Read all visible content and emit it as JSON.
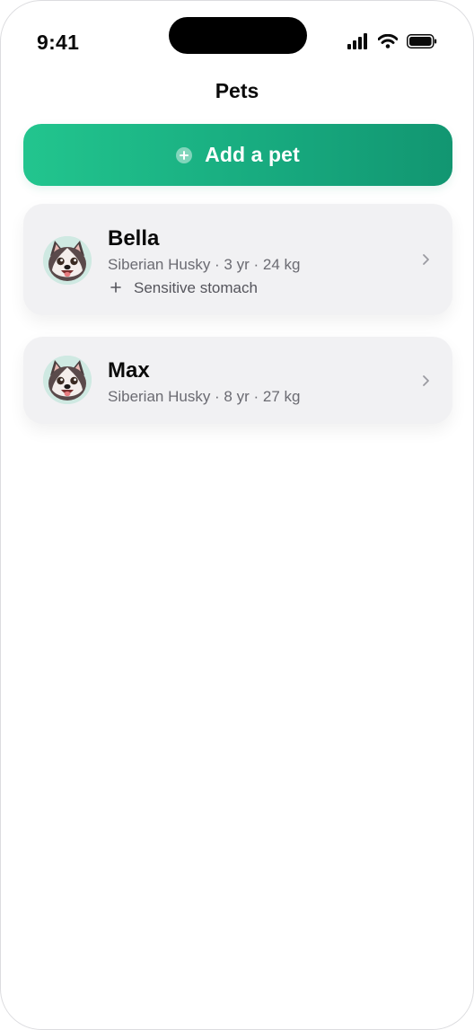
{
  "status_bar": {
    "time": "9:41"
  },
  "nav": {
    "title": "Pets"
  },
  "add_button": {
    "label": "Add a pet",
    "icon": "plus-circle-icon"
  },
  "pets": [
    {
      "name": "Bella",
      "meta": "Siberian Husky · 3 yr · 24 kg",
      "note": "Sensitive stomach",
      "avatar": "husky-avatar"
    },
    {
      "name": "Max",
      "meta": "Siberian Husky · 8 yr · 27 kg",
      "avatar": "husky-avatar"
    }
  ],
  "colors": {
    "accent_start": "#22c58e",
    "accent_end": "#129671",
    "card_bg": "#f1f1f3",
    "secondary_text": "#6b6b72"
  }
}
